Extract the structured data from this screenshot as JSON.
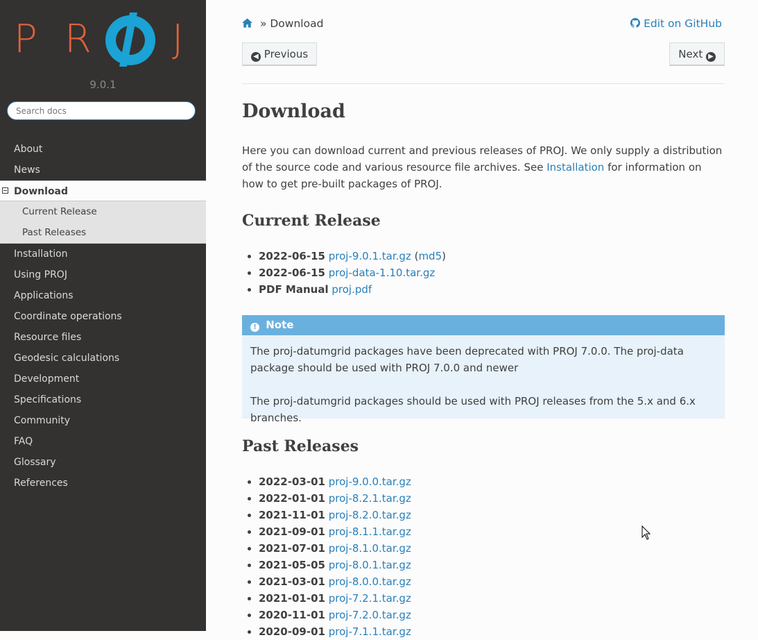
{
  "sidebar": {
    "logo_letters": [
      "P",
      "R",
      "J"
    ],
    "logo_symbol_color": "#1aa3d4",
    "logo_letter_color": "#e0623a",
    "version": "9.0.1",
    "search_placeholder": "Search docs",
    "items": [
      {
        "label": "About"
      },
      {
        "label": "News"
      },
      {
        "label": "Download",
        "current": true,
        "children": [
          {
            "label": "Current Release"
          },
          {
            "label": "Past Releases"
          }
        ]
      },
      {
        "label": "Installation"
      },
      {
        "label": "Using PROJ"
      },
      {
        "label": "Applications"
      },
      {
        "label": "Coordinate operations"
      },
      {
        "label": "Resource files"
      },
      {
        "label": "Geodesic calculations"
      },
      {
        "label": "Development"
      },
      {
        "label": "Specifications"
      },
      {
        "label": "Community"
      },
      {
        "label": "FAQ"
      },
      {
        "label": "Glossary"
      },
      {
        "label": "References"
      }
    ]
  },
  "header": {
    "breadcrumb_separator": "»",
    "breadcrumb_current": "Download",
    "edit_link": "Edit on GitHub",
    "prev_label": "Previous",
    "next_label": "Next"
  },
  "content": {
    "title": "Download",
    "intro_part1": "Here you can download current and previous releases of PROJ. We only supply a distribution of the source code and various resource file archives. See ",
    "intro_link": "Installation",
    "intro_part2": " for information on how to get pre-built packages of PROJ.",
    "current_release_heading": "Current Release",
    "current_release": [
      {
        "date": "2022-06-15",
        "file": "proj-9.0.1.tar.gz",
        "md5": "md5"
      },
      {
        "date": "2022-06-15",
        "file": "proj-data-1.10.tar.gz"
      },
      {
        "date": "PDF Manual",
        "file": "proj.pdf"
      }
    ],
    "note": {
      "title": "Note",
      "p1": "The proj-datumgrid packages have been deprecated with PROJ 7.0.0. The proj-data package should be used with PROJ 7.0.0 and newer",
      "p2": "The proj-datumgrid packages should be used with PROJ releases from the 5.x and 6.x branches."
    },
    "past_releases_heading": "Past Releases",
    "past_releases": [
      {
        "date": "2022-03-01",
        "file": "proj-9.0.0.tar.gz"
      },
      {
        "date": "2022-01-01",
        "file": "proj-8.2.1.tar.gz"
      },
      {
        "date": "2021-11-01",
        "file": "proj-8.2.0.tar.gz"
      },
      {
        "date": "2021-09-01",
        "file": "proj-8.1.1.tar.gz"
      },
      {
        "date": "2021-07-01",
        "file": "proj-8.1.0.tar.gz"
      },
      {
        "date": "2021-05-05",
        "file": "proj-8.0.1.tar.gz"
      },
      {
        "date": "2021-03-01",
        "file": "proj-8.0.0.tar.gz"
      },
      {
        "date": "2021-01-01",
        "file": "proj-7.2.1.tar.gz"
      },
      {
        "date": "2020-11-01",
        "file": "proj-7.2.0.tar.gz"
      },
      {
        "date": "2020-09-01",
        "file": "proj-7.1.1.tar.gz"
      }
    ]
  }
}
